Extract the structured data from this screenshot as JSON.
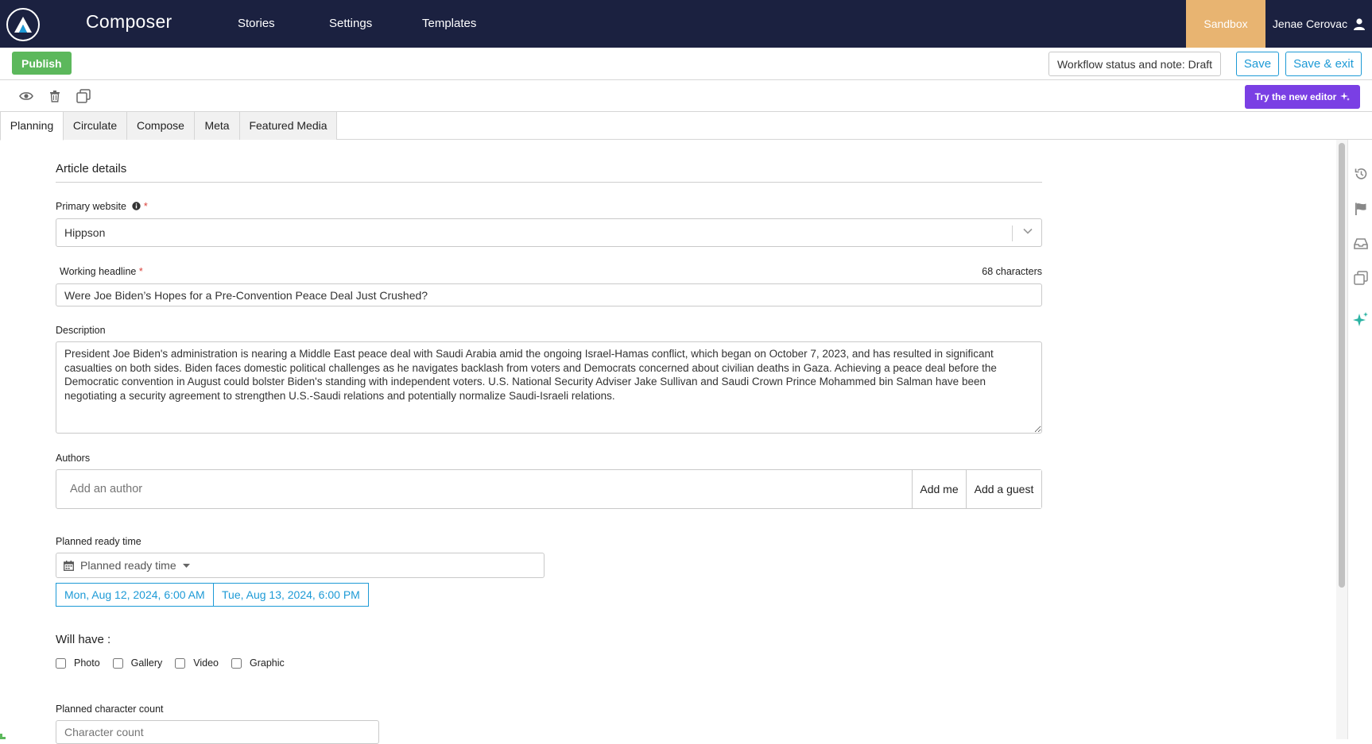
{
  "nav": {
    "app_title": "Composer",
    "links": [
      "Stories",
      "Settings",
      "Templates"
    ],
    "sandbox": "Sandbox",
    "user_name": "Jenae Cerovac"
  },
  "actions": {
    "publish": "Publish",
    "workflow": "Workflow status and note: Draft",
    "save": "Save",
    "save_exit": "Save & exit"
  },
  "toolbar": {
    "icons": [
      "eye-icon",
      "trash-icon",
      "copy-icon"
    ],
    "new_editor": "Try the new editor"
  },
  "tabs": [
    "Planning",
    "Circulate",
    "Compose",
    "Meta",
    "Featured Media"
  ],
  "active_tab": "Planning",
  "form": {
    "section_title": "Article details",
    "primary_website": {
      "label": "Primary website",
      "required_mark": "*",
      "value": "Hippson"
    },
    "working_headline": {
      "label": "Working headline",
      "required_mark": "*",
      "char_count": "68 characters",
      "value": "Were Joe Biden’s Hopes for a Pre-Convention Peace Deal Just Crushed?"
    },
    "description": {
      "label": "Description",
      "value": "President Joe Biden's administration is nearing a Middle East peace deal with Saudi Arabia amid the ongoing Israel-Hamas conflict, which began on October 7, 2023, and has resulted in significant casualties on both sides. Biden faces domestic political challenges as he navigates backlash from voters and Democrats concerned about civilian deaths in Gaza. Achieving a peace deal before the Democratic convention in August could bolster Biden's standing with independent voters. U.S. National Security Adviser Jake Sullivan and Saudi Crown Prince Mohammed bin Salman have been negotiating a security agreement to strengthen U.S.-Saudi relations and potentially normalize Saudi-Israeli relations."
    },
    "authors": {
      "label": "Authors",
      "placeholder": "Add an author",
      "add_me": "Add me",
      "add_guest": "Add a guest"
    },
    "planned_ready_time": {
      "label": "Planned ready time",
      "picker_text": "Planned ready time",
      "start": "Mon, Aug 12, 2024, 6:00 AM",
      "end": "Tue, Aug 13, 2024, 6:00 PM"
    },
    "will_have": {
      "label": "Will have :",
      "options": [
        "Photo",
        "Gallery",
        "Video",
        "Graphic"
      ]
    },
    "planned_char_count": {
      "label": "Planned character count",
      "placeholder": "Character count"
    }
  },
  "right_rail": [
    "history-icon",
    "flag-icon",
    "inbox-icon",
    "copy-icon",
    "sparkle-icon"
  ],
  "colors": {
    "nav_bg": "#1b2140",
    "sandbox": "#e8b471",
    "publish": "#5cb85c",
    "accent": "#1d9ad6",
    "new_editor": "#7a3fe4",
    "required": "#d9403a",
    "sparkle": "#2bb3a3"
  }
}
